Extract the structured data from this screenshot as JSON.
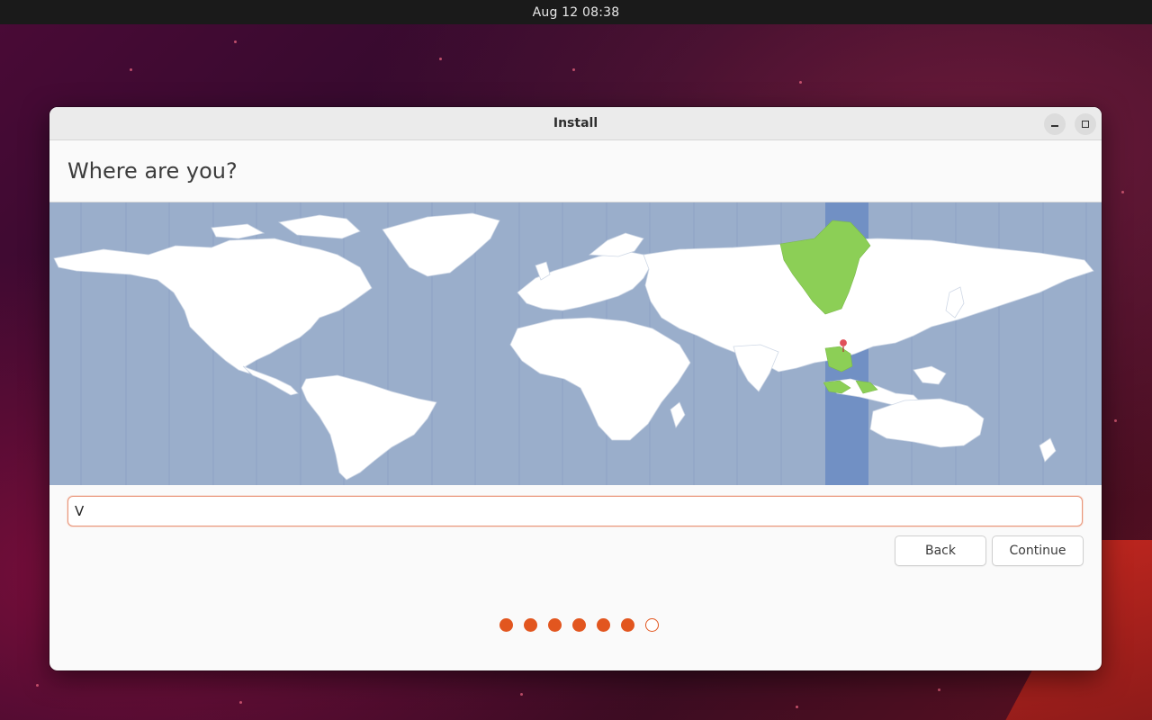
{
  "topbar": {
    "clock": "Aug 12  08:38"
  },
  "window": {
    "title": "Install",
    "minimize_icon": "minimize-icon",
    "maximize_icon": "maximize-icon"
  },
  "page": {
    "heading": "Where are you?"
  },
  "map": {
    "ocean_color": "#9aaecb",
    "land_color": "#ffffff",
    "highlight_color": "#8ccf56",
    "zone_band_color": "#7190c4",
    "marker_color": "#e0505a"
  },
  "location": {
    "value": "V",
    "placeholder": ""
  },
  "buttons": {
    "back": "Back",
    "continue": "Continue"
  },
  "progress": {
    "total_steps": 7,
    "completed_steps": 6,
    "accent": "#e2561f"
  }
}
